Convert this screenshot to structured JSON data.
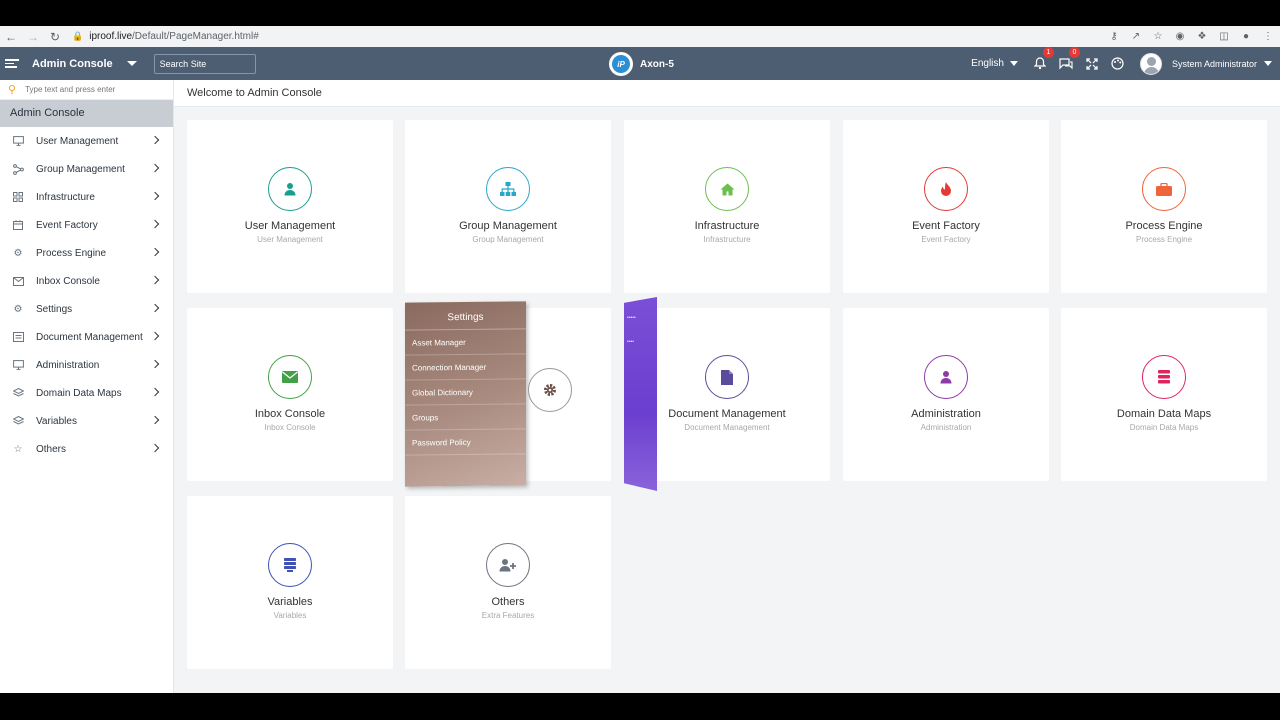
{
  "browser": {
    "url_host": "iproof.live",
    "url_path": "/Default/PageManager.html#"
  },
  "header": {
    "app_title": "Admin Console",
    "search_placeholder": "Search Site",
    "brand_logo": "iP",
    "brand_name": "Axon-5",
    "language": "English",
    "notifications_count": "1",
    "messages_count": "0",
    "user_name": "System Administrator"
  },
  "sidebar": {
    "search_placeholder": "Type text and press enter",
    "header": "Admin Console",
    "items": [
      {
        "label": "User Management",
        "icon": "monitor-icon"
      },
      {
        "label": "Group Management",
        "icon": "network-icon"
      },
      {
        "label": "Infrastructure",
        "icon": "grid-icon"
      },
      {
        "label": "Event Factory",
        "icon": "calendar-icon"
      },
      {
        "label": "Process Engine",
        "icon": "gear-icon"
      },
      {
        "label": "Inbox Console",
        "icon": "mail-icon"
      },
      {
        "label": "Settings",
        "icon": "gear-icon"
      },
      {
        "label": "Document Management",
        "icon": "document-icon"
      },
      {
        "label": "Administration",
        "icon": "monitor-icon"
      },
      {
        "label": "Domain Data Maps",
        "icon": "layers-icon"
      },
      {
        "label": "Variables",
        "icon": "layers-icon"
      },
      {
        "label": "Others",
        "icon": "star-icon"
      }
    ]
  },
  "main": {
    "welcome": "Welcome to Admin Console",
    "cards": [
      {
        "title": "User Management",
        "subtitle": "User Management",
        "icon": "user-icon",
        "color": "#1a9e8f"
      },
      {
        "title": "Group Management",
        "subtitle": "Group Management",
        "icon": "sitemap-icon",
        "color": "#2aa6c9"
      },
      {
        "title": "Infrastructure",
        "subtitle": "Infrastructure",
        "icon": "home-icon",
        "color": "#6cbf4f"
      },
      {
        "title": "Event Factory",
        "subtitle": "Event Factory",
        "icon": "fire-icon",
        "color": "#e53935"
      },
      {
        "title": "Process Engine",
        "subtitle": "Process Engine",
        "icon": "briefcase-icon",
        "color": "#f0643c"
      },
      {
        "title": "Inbox Console",
        "subtitle": "Inbox Console",
        "icon": "envelope-icon",
        "color": "#43a047"
      },
      {
        "title": "Document Management",
        "subtitle": "Document Management",
        "icon": "file-icon",
        "color": "#5c4b9a"
      },
      {
        "title": "Administration",
        "subtitle": "Administration",
        "icon": "user-icon",
        "color": "#8e3aa8"
      },
      {
        "title": "Domain Data Maps",
        "subtitle": "Domain Data Maps",
        "icon": "database-icon",
        "color": "#e0245e"
      },
      {
        "title": "Variables",
        "subtitle": "Variables",
        "icon": "list-icon",
        "color": "#3f51b5"
      },
      {
        "title": "Others",
        "subtitle": "Extra Features",
        "icon": "user-plus-icon",
        "color": "#6d7480"
      }
    ],
    "settings_flip": {
      "title": "Settings",
      "items": [
        "Asset Manager",
        "Connection Manager",
        "Global Dictionary",
        "Groups",
        "Password Policy"
      ]
    }
  }
}
